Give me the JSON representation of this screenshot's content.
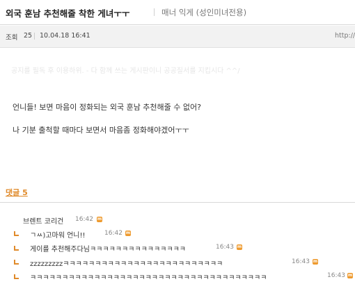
{
  "post": {
    "title": "외국 훈남 추천해줄 착한 게녀ㅜㅜ",
    "board": "매너 익게 (성인미녀전용)",
    "views_label": "조회",
    "views": "25",
    "date": "10.04.18 16:41",
    "url_fragment": "http://",
    "notice": "공지를 필독 후 이용하위. - 다 함께 쓰는 게시판이니 공공질서를 지킵시다 ^^/",
    "body_lines": [
      "언니들! 보면 마음이 정화되는 외국 훈남 추천해줄 수 없어?",
      "나 기분 출척할 때마다 보면서 마음좀 정화해야겠어ㅜㅜ"
    ]
  },
  "comments": {
    "heading": "댓글 5",
    "items": [
      {
        "author": "브렌트 코리건",
        "text": "",
        "time": "16:42",
        "badge": "m"
      },
      {
        "author": "",
        "text": "ㄱㅆ)고마워 언니!!",
        "time": "16:42",
        "badge": "m"
      },
      {
        "author": "",
        "text": "게이를 추천해주다님ㅋㅋㅋㅋㅋㅋㅋㅋㅋㅋㅋㅋㅋㅋㅋ",
        "time": "16:43",
        "badge": "m"
      },
      {
        "author": "",
        "text": "zzzzzzzzzㅋㅋㅋㅋㅋㅋㅋㅋㅋㅋㅋㅋㅋㅋㅋㅋㅋㅋㅋㅋㅋㅋㅋㅋㅋ",
        "time": "16:43",
        "badge": "m"
      },
      {
        "author": "",
        "text": "ㅋㅋㅋㅋㅋㅋㅋㅋㅋㅋㅋㅋㅋㅋㅋㅋㅋㅋㅋㅋㅋㅋㅋㅋㅋㅋㅋㅋㅋㅋㅋㅋㅋㅋㅋㅋㅋ",
        "time": "16:43",
        "badge": "m"
      }
    ]
  },
  "colors": {
    "accent": "#e08a2a",
    "badge": "#ee9a2e"
  }
}
